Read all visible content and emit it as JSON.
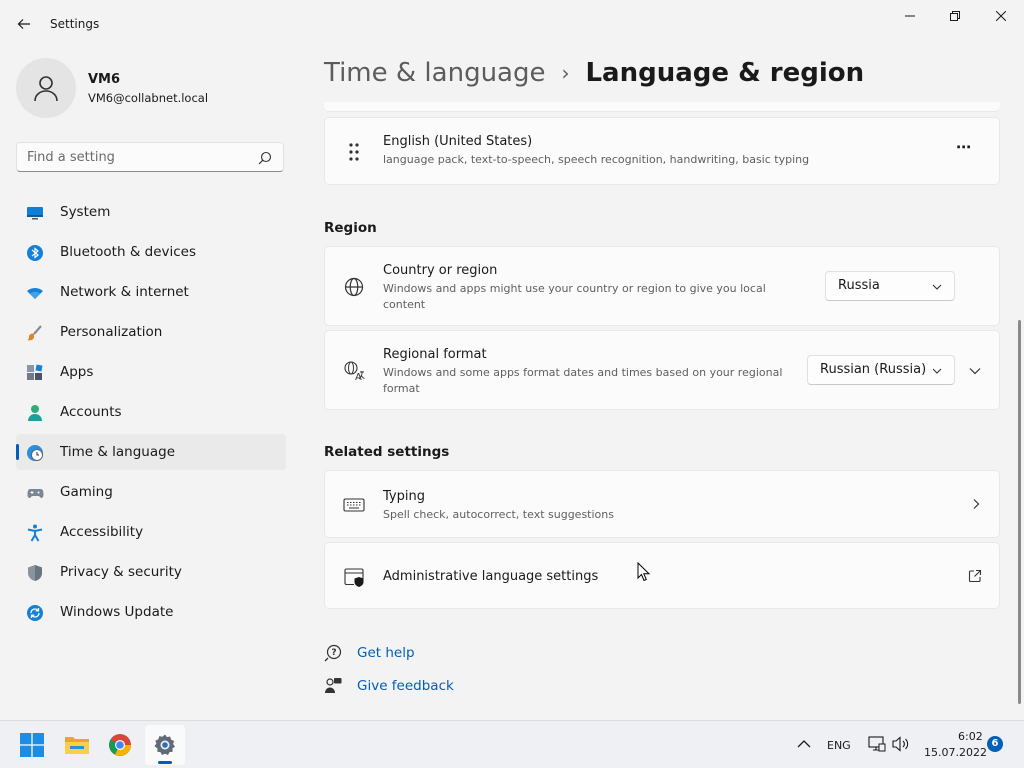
{
  "window": {
    "title": "Settings"
  },
  "profile": {
    "name": "VM6",
    "email": "VM6@collabnet.local"
  },
  "search": {
    "placeholder": "Find a setting"
  },
  "nav": [
    {
      "label": "System",
      "icon": "monitor-icon"
    },
    {
      "label": "Bluetooth & devices",
      "icon": "bluetooth-icon"
    },
    {
      "label": "Network & internet",
      "icon": "wifi-icon"
    },
    {
      "label": "Personalization",
      "icon": "brush-icon"
    },
    {
      "label": "Apps",
      "icon": "apps-icon"
    },
    {
      "label": "Accounts",
      "icon": "person-icon"
    },
    {
      "label": "Time & language",
      "icon": "globe-clock-icon",
      "active": true
    },
    {
      "label": "Gaming",
      "icon": "gamepad-icon"
    },
    {
      "label": "Accessibility",
      "icon": "accessibility-icon"
    },
    {
      "label": "Privacy & security",
      "icon": "shield-icon"
    },
    {
      "label": "Windows Update",
      "icon": "update-icon"
    }
  ],
  "breadcrumb": {
    "parent": "Time & language",
    "separator": "›",
    "current": "Language & region"
  },
  "language_card": {
    "title": "English (United States)",
    "desc": "language pack, text-to-speech, speech recognition, handwriting, basic typing",
    "more": "⋯"
  },
  "region": {
    "title": "Region",
    "country": {
      "title": "Country or region",
      "desc": "Windows and apps might use your country or region to give you local content",
      "value": "Russia"
    },
    "format": {
      "title": "Regional format",
      "desc": "Windows and some apps format dates and times based on your regional format",
      "value": "Russian (Russia)"
    }
  },
  "related": {
    "title": "Related settings",
    "typing": {
      "title": "Typing",
      "desc": "Spell check, autocorrect, text suggestions"
    },
    "admin": {
      "title": "Administrative language settings"
    }
  },
  "links": {
    "help": "Get help",
    "feedback": "Give feedback"
  },
  "taskbar": {
    "apps": [
      "start-icon",
      "file-explorer-icon",
      "chrome-icon",
      "settings-icon"
    ],
    "lang": "ENG",
    "time": "6:02",
    "date": "15.07.2022",
    "notifications": "6"
  },
  "colors": {
    "accent": "#005fb8",
    "background": "#f3f3f3",
    "card": "#fbfbfb"
  }
}
